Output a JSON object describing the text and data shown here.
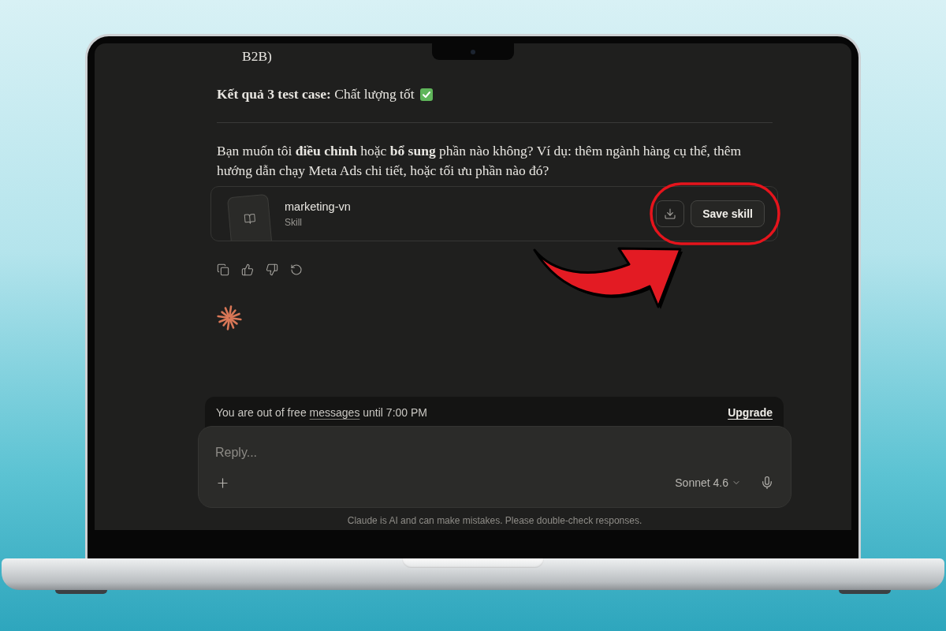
{
  "message": {
    "list_continuation": "B2B)",
    "result_line": "**Kết quả 3 test case:** Chất lượng tốt",
    "follow_up": "Bạn muốn tôi **điều chỉnh** hoặc **bổ sung** phần nào không? Ví dụ: thêm ngành hàng cụ thể, thêm hướng dẫn chạy Meta Ads chi tiết, hoặc tối ưu phần nào đó?"
  },
  "skill_card": {
    "name": "marketing-vn",
    "type": "Skill",
    "save_button": "Save skill"
  },
  "limit_notice": {
    "text_before": "You are out of free",
    "link": "messages",
    "text_after": "until 7:00 PM",
    "action": "Upgrade"
  },
  "composer": {
    "placeholder": "Reply...",
    "model": "Sonnet 4.6"
  },
  "disclaimer": "Claude is AI and can make mistakes. Please double-check responses."
}
